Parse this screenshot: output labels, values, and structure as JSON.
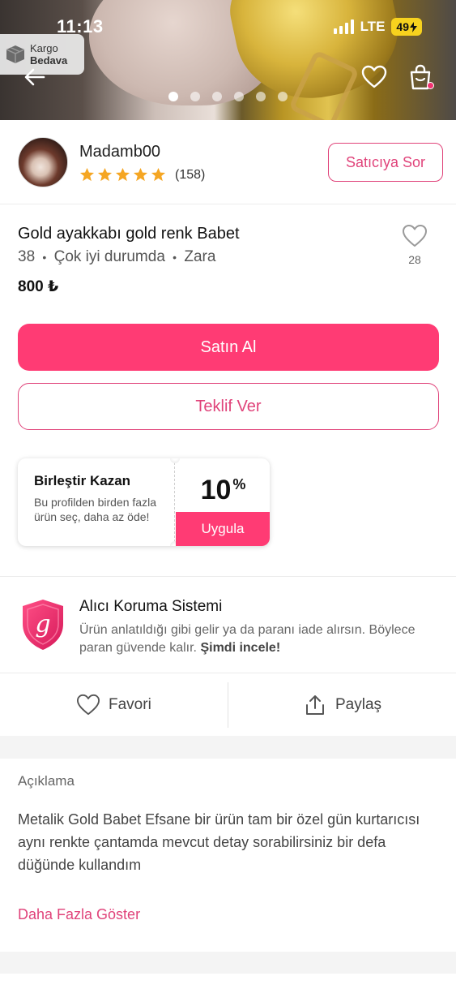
{
  "status_bar": {
    "time": "11:13",
    "network": "LTE",
    "battery": "49"
  },
  "hero": {
    "badge": {
      "line1": "Kargo",
      "line2": "Bedava",
      "icon": "box-icon"
    },
    "image_count": 6,
    "active_image": 1,
    "icons": [
      "back-arrow-icon",
      "heart-icon",
      "shopping-bag-icon"
    ]
  },
  "seller": {
    "name": "Madamb00",
    "rating_stars": 5,
    "rating_count": "(158)",
    "ask_button": "Satıcıya Sor"
  },
  "product": {
    "title": "Gold ayakkabı gold renk Babet",
    "size": "38",
    "condition": "Çok iyi durumda",
    "brand": "Zara",
    "separator": "•",
    "price": "800 ₺",
    "like_count": "28"
  },
  "buttons": {
    "buy": "Satın Al",
    "offer": "Teklif Ver"
  },
  "promo": {
    "title": "Birleştir Kazan",
    "description": "Bu profilden birden fazla ürün seç, daha az öde!",
    "percent": "10",
    "percent_sign": "%",
    "apply": "Uygula"
  },
  "protection": {
    "title": "Alıcı Koruma Sistemi",
    "description": "Ürün anlatıldığı gibi gelir ya da paranı iade alırsın. Böylece paran güvende kalır.",
    "link": "Şimdi incele!",
    "logo_letter": "g"
  },
  "actions": {
    "favorite": "Favori",
    "share": "Paylaş"
  },
  "description": {
    "label": "Açıklama",
    "text": "Metalik Gold Babet Efsane bir ürün tam bir özel gün kurtarıcısı aynı renkte çantamda mevcut detay sorabilirsiniz bir defa düğünde kullandım",
    "more": "Daha Fazla Göster"
  },
  "colors": {
    "brand_pink": "#ff3b74",
    "outline_pink": "#e0437a",
    "star_orange": "#f5a623",
    "battery_yellow": "#f7d21e"
  }
}
